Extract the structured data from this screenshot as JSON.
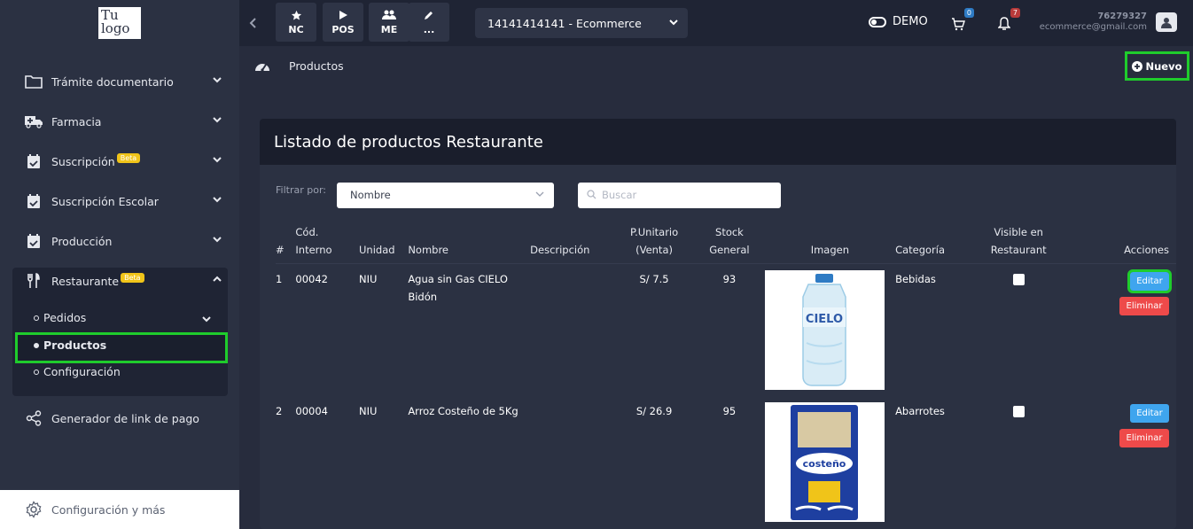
{
  "app": {
    "logo_text": "Tu logo"
  },
  "sidebar": {
    "items": [
      {
        "label": "Trámite documentario"
      },
      {
        "label": "Farmacia"
      },
      {
        "label": "Suscripción",
        "badge": "Beta"
      },
      {
        "label": "Suscripción Escolar"
      },
      {
        "label": "Producción"
      },
      {
        "label": "Restaurante",
        "badge": "Beta"
      },
      {
        "label": "Generador de link de pago"
      }
    ],
    "restaurant_sub": [
      {
        "label": "Pedidos"
      },
      {
        "label": "Productos"
      },
      {
        "label": "Configuración"
      }
    ],
    "footer_label": "Configuración y más"
  },
  "topbar": {
    "buttons": [
      {
        "label": "NC",
        "icon": "star-icon"
      },
      {
        "label": "POS",
        "icon": "play-icon"
      },
      {
        "label": "ME",
        "icon": "users-icon"
      },
      {
        "label": "...",
        "icon": "pencil-icon"
      }
    ],
    "company": "14141414141 - Ecommerce",
    "mode_label": "DEMO",
    "cart_count": "0",
    "notif_count": "7",
    "user_id": "76279327",
    "user_email": "ecommerce@gmail.com"
  },
  "breadcrumb": {
    "current": "Productos"
  },
  "new_button": "Nuevo",
  "card": {
    "title": "Listado de productos Restaurante",
    "filter_label": "Filtrar por:",
    "filter_value": "Nombre",
    "search_placeholder": "Buscar",
    "columns": {
      "num": "#",
      "code_1": "Cód.",
      "code_2": "Interno",
      "unit": "Unidad",
      "name": "Nombre",
      "desc": "Descripción",
      "price_1": "P.Unitario",
      "price_2": "(Venta)",
      "stock_1": "Stock",
      "stock_2": "General",
      "image": "Imagen",
      "category": "Categoría",
      "visible_1": "Visible en",
      "visible_2": "Restaurant",
      "actions": "Acciones"
    },
    "rows": [
      {
        "num": "1",
        "code": "00042",
        "unit": "NIU",
        "name": "Agua sin Gas CIELO Bidón",
        "desc": "",
        "price": "S/ 7.5",
        "stock": "93",
        "category": "Bebidas"
      },
      {
        "num": "2",
        "code": "00004",
        "unit": "NIU",
        "name": "Arroz Costeño de 5Kg",
        "desc": "",
        "price": "S/ 26.9",
        "stock": "95",
        "category": "Abarrotes"
      }
    ],
    "edit_label": "Editar",
    "delete_label": "Eliminar",
    "image_text_1": "CIELO",
    "image_text_2": "costeño"
  }
}
